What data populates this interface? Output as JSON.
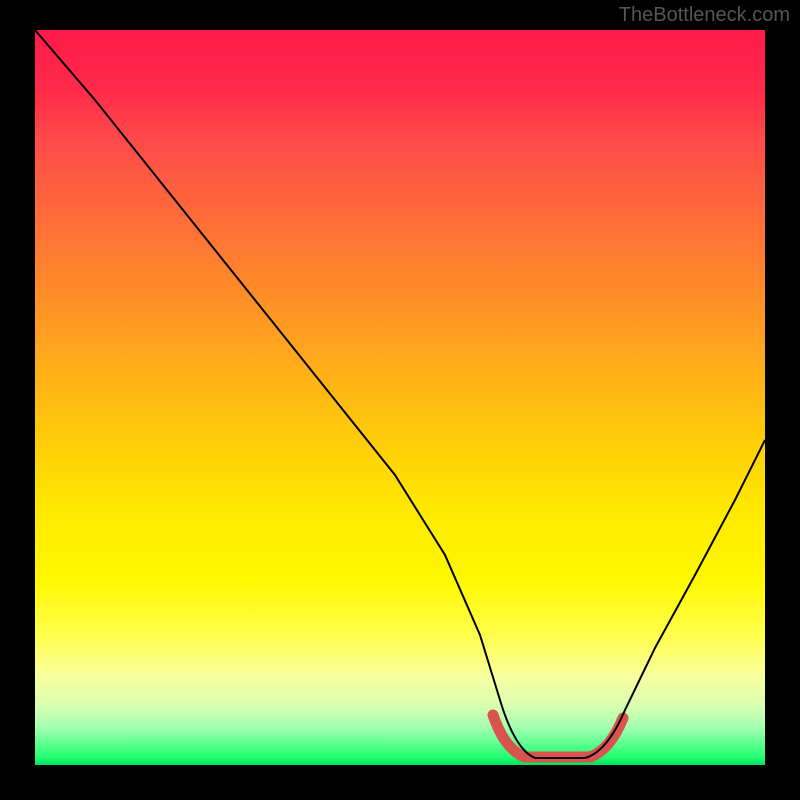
{
  "watermark": "TheBottleneck.com",
  "chart_data": {
    "type": "line",
    "title": "",
    "xlabel": "",
    "ylabel": "",
    "xlim": [
      0,
      100
    ],
    "ylim": [
      0,
      100
    ],
    "x": [
      0,
      5,
      10,
      15,
      20,
      25,
      30,
      35,
      40,
      45,
      50,
      55,
      60,
      63,
      65,
      68,
      70,
      72,
      74,
      76,
      78,
      80,
      85,
      90,
      95,
      100
    ],
    "values": [
      100,
      93,
      86,
      79,
      72,
      65,
      58,
      51,
      44,
      37,
      30,
      23,
      14,
      8,
      4,
      1,
      0,
      0,
      0,
      0,
      1,
      3,
      10,
      20,
      32,
      45
    ],
    "accent_region": {
      "x_start": 63,
      "x_end": 80,
      "description": "bottom flat region highlighted"
    },
    "background": "rainbow vertical gradient (red top to green bottom)"
  }
}
